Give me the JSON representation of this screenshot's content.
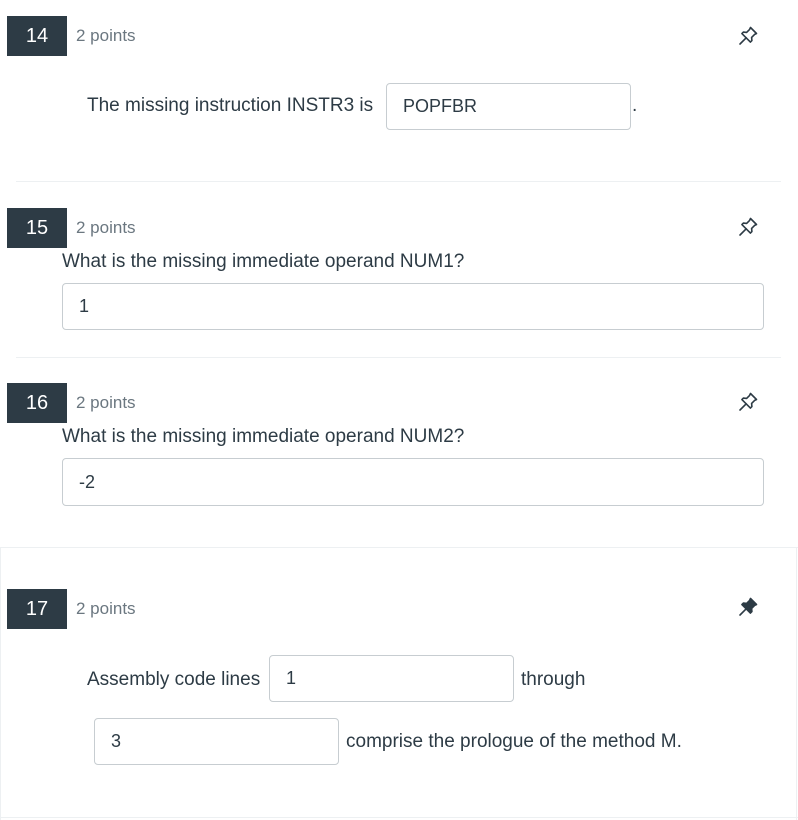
{
  "questions": [
    {
      "number": "14",
      "points": "2 points",
      "prompt_before": "The missing instruction INSTR3 is",
      "answer": "POPFBR",
      "prompt_after": ".",
      "pin_icon": "pin-outline-icon"
    },
    {
      "number": "15",
      "points": "2 points",
      "prompt": "What is the missing immediate operand NUM1?",
      "answer": "1",
      "pin_icon": "pin-outline-icon"
    },
    {
      "number": "16",
      "points": "2 points",
      "prompt": "What is the missing immediate operand NUM2?",
      "answer": "-2",
      "pin_icon": "pin-outline-icon"
    },
    {
      "number": "17",
      "points": "2 points",
      "text_1": "Assembly code lines",
      "answer_1": "1",
      "text_2": "through",
      "answer_2": "3",
      "text_3": "comprise the prologue of the method M.",
      "pin_icon": "pin-filled-icon"
    }
  ]
}
